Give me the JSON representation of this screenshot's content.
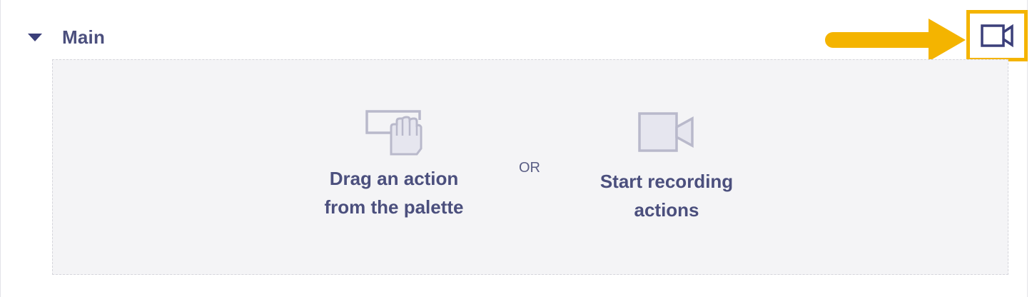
{
  "section": {
    "title": "Main",
    "expanded": true
  },
  "drop_zone": {
    "drag_option": {
      "label": "Drag an action\nfrom the palette",
      "icon": "drag-hand-icon"
    },
    "separator": "OR",
    "record_option": {
      "label": "Start recording\nactions",
      "icon": "video-camera-icon"
    }
  },
  "toolbar": {
    "record_button_icon": "video-camera-icon",
    "highlight_color": "#f4b400"
  },
  "colors": {
    "accent": "#3b3f7a",
    "text": "#4b4f7d",
    "icon_muted": "#b9b9cb",
    "highlight": "#f4b400"
  }
}
